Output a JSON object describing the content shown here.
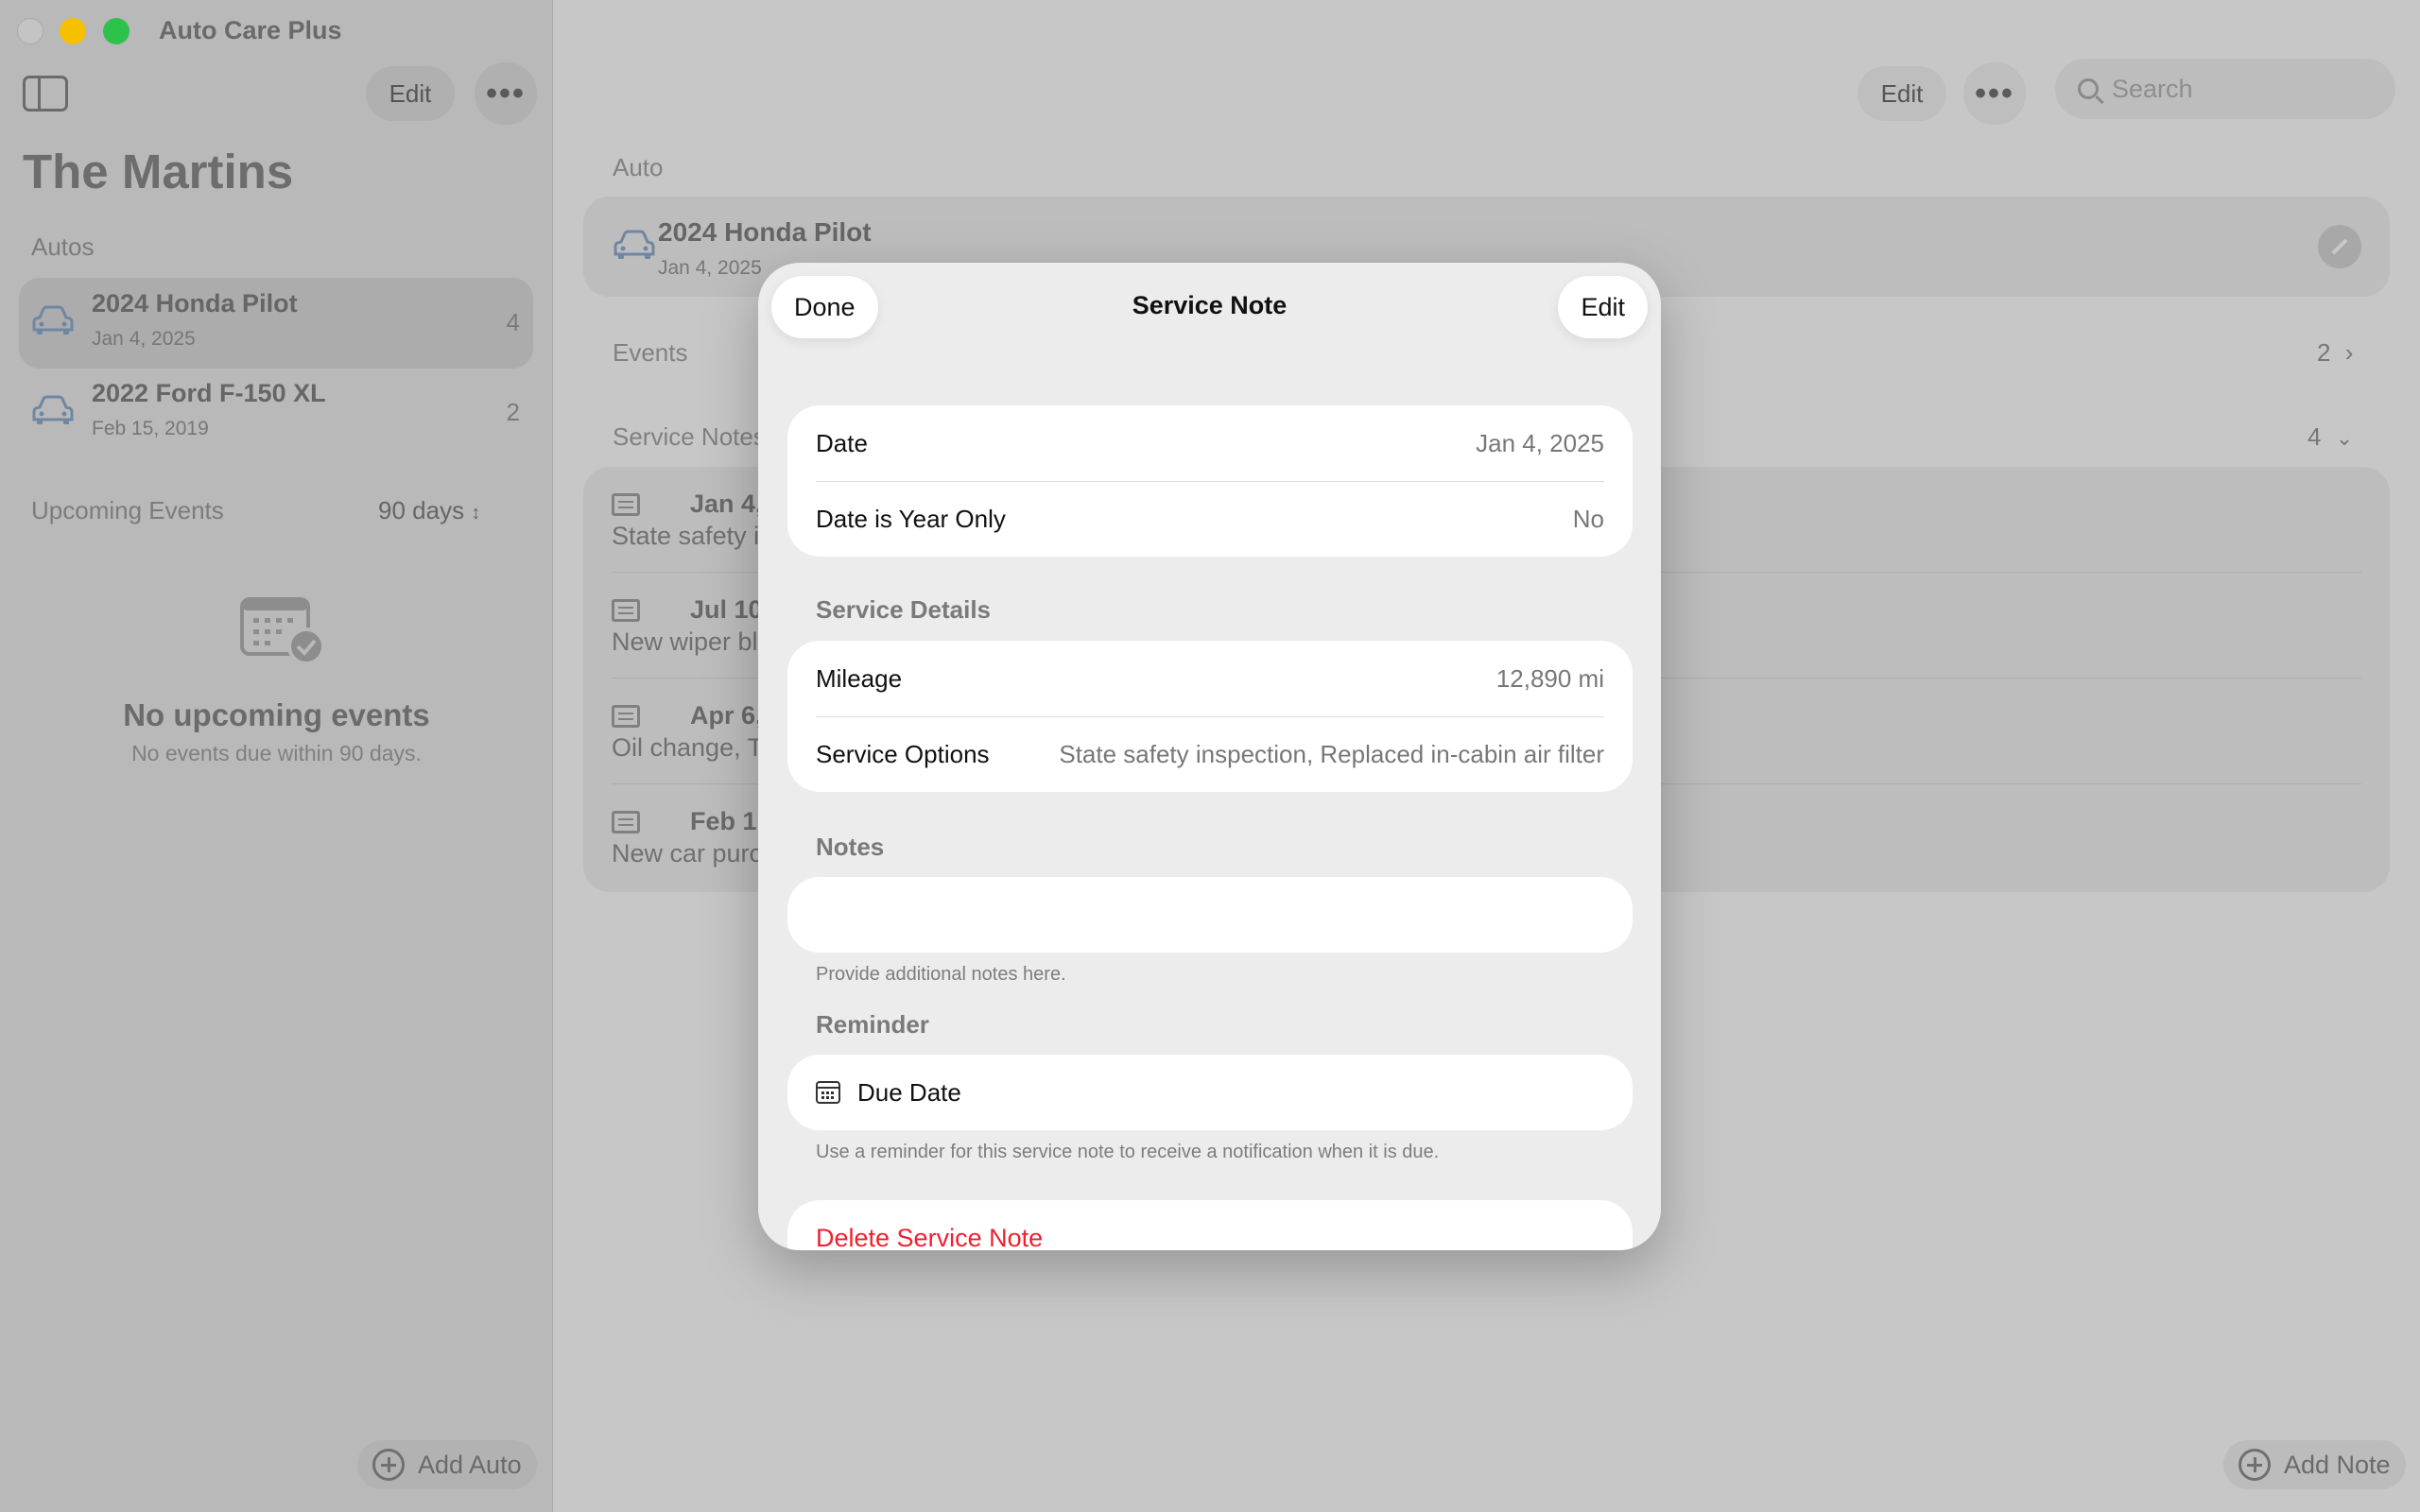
{
  "app": {
    "title": "Auto Care Plus"
  },
  "sidebar": {
    "edit_label": "Edit",
    "more_label": "•••",
    "family_name": "The Martins",
    "autos_label": "Autos",
    "autos": [
      {
        "name": "2024 Honda Pilot",
        "date": "Jan 4, 2025",
        "count": "4",
        "selected": true
      },
      {
        "name": "2022 Ford F-150 XL",
        "date": "Feb 15, 2019",
        "count": "2",
        "selected": false
      }
    ],
    "upcoming_label": "Upcoming Events",
    "days_filter": "90 days",
    "empty_title": "No upcoming events",
    "empty_subtitle": "No events due within 90 days.",
    "add_auto_label": "Add Auto"
  },
  "main": {
    "edit_label": "Edit",
    "more_label": "•••",
    "search_placeholder": "Search",
    "auto_label": "Auto",
    "auto": {
      "name": "2024 Honda Pilot",
      "date": "Jan 4, 2025"
    },
    "events_label": "Events",
    "events_count": "2",
    "service_notes_label": "Service Notes",
    "service_notes_count": "4",
    "notes": [
      {
        "title": "Jan 4, 2025",
        "subtitle": "State safety inspection"
      },
      {
        "title": "Jul 10, 2024",
        "subtitle": "New wiper blades"
      },
      {
        "title": "Apr 6, 2024",
        "subtitle": "Oil change, Tire rotation"
      },
      {
        "title": "Feb 1, 2024",
        "subtitle": "New car purchase"
      }
    ],
    "add_note_label": "Add Note"
  },
  "modal": {
    "done_label": "Done",
    "title": "Service Note",
    "edit_label": "Edit",
    "date_label": "Date",
    "date_value": "Jan 4, 2025",
    "year_only_label": "Date is Year Only",
    "year_only_value": "No",
    "service_details_header": "Service Details",
    "mileage_label": "Mileage",
    "mileage_value": "12,890 mi",
    "service_options_label": "Service Options",
    "service_options_value": "State safety inspection, Replaced in-cabin air filter",
    "notes_header": "Notes",
    "notes_value": "",
    "notes_footer": "Provide additional notes here.",
    "reminder_header": "Reminder",
    "due_date_label": "Due Date",
    "reminder_footer": "Use a reminder for this service note to receive a notification when it is due.",
    "delete_label": "Delete Service Note"
  },
  "colors": {
    "accent": "#f0202e",
    "dim_background": "#c8c8c8"
  }
}
